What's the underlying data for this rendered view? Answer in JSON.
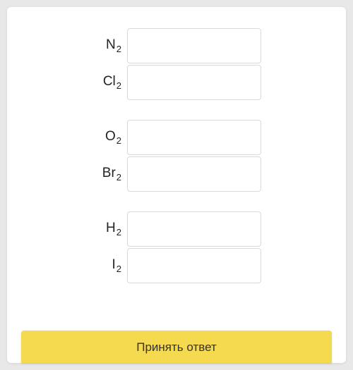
{
  "groups": [
    {
      "rows": [
        {
          "symbol": "N",
          "sub": "2",
          "value": ""
        },
        {
          "symbol": "Cl",
          "sub": "2",
          "value": ""
        }
      ]
    },
    {
      "rows": [
        {
          "symbol": "O",
          "sub": "2",
          "value": ""
        },
        {
          "symbol": "Br",
          "sub": "2",
          "value": ""
        }
      ]
    },
    {
      "rows": [
        {
          "symbol": "H",
          "sub": "2",
          "value": ""
        },
        {
          "symbol": "I",
          "sub": "2",
          "value": ""
        }
      ]
    }
  ],
  "submit_label": "Принять ответ"
}
